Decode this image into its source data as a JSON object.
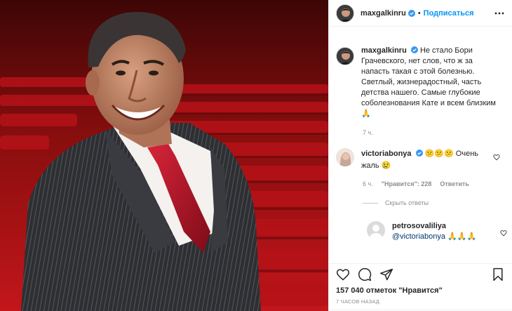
{
  "header": {
    "username": "maxgalkinru",
    "separator": "•",
    "follow_label": "Подписаться"
  },
  "caption": {
    "username": "maxgalkinru",
    "text": "Не стало Бори Грачевского, нет слов, что ж за напасть такая с этой болезнью. Светлый, жизнерадостный, часть детства нашего. Самые глубокие соболезнования Кате и всем близким🙏",
    "time": "7 ч."
  },
  "comment": {
    "username": "victoriabonya",
    "text": "😕😕😕 Очень жаль 😢",
    "time": "6 ч.",
    "likes": "\"Нравится\": 228",
    "reply_label": "Ответить",
    "hide_replies": "Скрыть ответы"
  },
  "reply": {
    "username": "petrosovaliliya",
    "mention": "@victoriabonya",
    "text": "🙏🙏🙏"
  },
  "likes_text": "157 040 отметок \"Нравится\"",
  "posted_ago": "7 часов назад",
  "icons": {
    "more": "more-icon",
    "verified": "verified-badge-icon",
    "like": "heart-icon",
    "comment": "comment-icon",
    "share": "share-icon",
    "save": "bookmark-icon"
  },
  "colors": {
    "accent": "#0095f6",
    "verified": "#3897f0",
    "secondary_text": "#8e8e8e",
    "mention": "#00376b"
  }
}
